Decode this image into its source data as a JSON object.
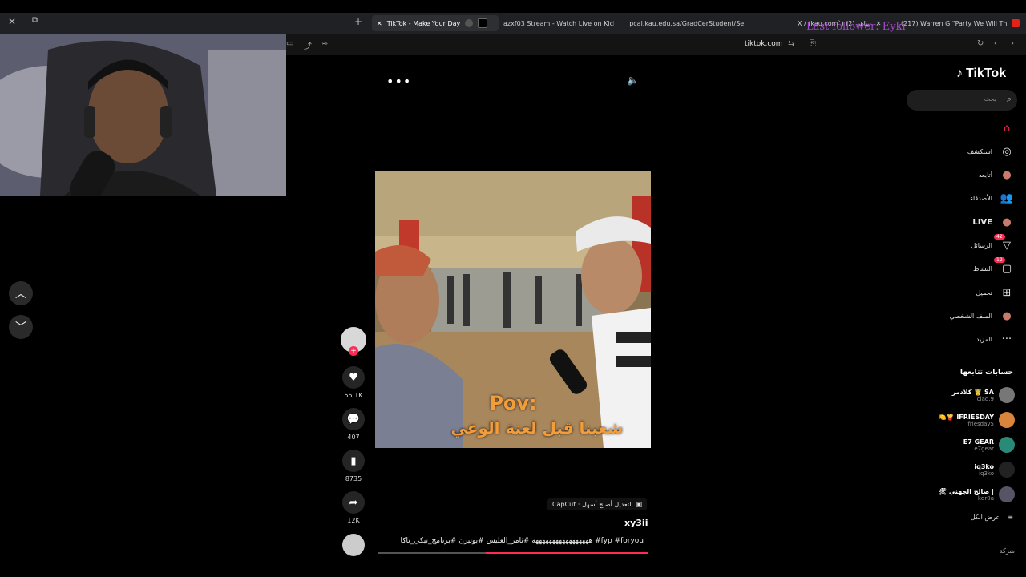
{
  "browser": {
    "tabs": [
      {
        "label": "TikTok - Make Your Day",
        "active": true
      },
      {
        "label": "azxf03 Stream - Watch Live on Kick"
      },
      {
        "label": "!pcal.kau.edu.sa/GradCerStudent/Se"
      },
      {
        "label": "X / (kau.com`) ساهر (2)"
      },
      {
        "label": "(217) Warren G \"Party We Will Th"
      }
    ],
    "url": "tiktok.com",
    "controls": {
      "close": "✕",
      "restore": "⧉",
      "minimize": "–",
      "new_tab": "+"
    }
  },
  "overlay": {
    "last_follower": "Last follower: Eyki"
  },
  "colors": {
    "accent": "#fe2c55",
    "sidebar_bg": "#000000",
    "overlay_text": "#a049c6"
  },
  "video": {
    "caption_pov": "Pov:",
    "caption_ar": "شعبنا قبل لعنة الوعي",
    "capcut_badge": "CapCut · التعديل أصبح أسهل",
    "author": "xy3ii",
    "description": "هههههههههههههههههه #ثامر_الغليس #يوتيرن #برنامج_تيكي_تاكا #fyp #foryou",
    "progress": 0.6
  },
  "actions": {
    "likes": "55.1K",
    "comments": "407",
    "saves": "8735",
    "shares": "12K"
  },
  "sidebar": {
    "logo": "TikTok",
    "search_placeholder": "بحث",
    "nav": [
      {
        "label": "",
        "icon": "home-icon"
      },
      {
        "label": "استكشف",
        "icon": "explore-icon"
      },
      {
        "label": "أتابعه",
        "icon": "following-avatar-icon"
      },
      {
        "label": "الأصدقاء",
        "icon": "friends-icon"
      },
      {
        "label": "LIVE",
        "icon": "live-icon"
      },
      {
        "label": "الرسائل",
        "icon": "messages-icon",
        "badge": "42"
      },
      {
        "label": "النشاط",
        "icon": "activity-icon",
        "badge": "12"
      },
      {
        "label": "تحميل",
        "icon": "upload-icon"
      },
      {
        "label": "الملف الشخصي",
        "icon": "profile-icon"
      },
      {
        "label": "المزيد",
        "icon": "more-icon"
      }
    ],
    "following_header": "حسابات تتابعها",
    "accounts": [
      {
        "name": "كلادمر 🤴 SA",
        "handle": "clad.9",
        "color": "#777"
      },
      {
        "name": "🍋🍟 IFRIESDAY",
        "handle": "friesday5",
        "color": "#d9853b"
      },
      {
        "name": "E7 GEAR",
        "handle": "e7gear",
        "color": "#2a8a78"
      },
      {
        "name": "iq3ko",
        "handle": "iq3ko",
        "color": "#222"
      },
      {
        "name": "🛠 صالح الجهني |",
        "handle": "kdr0a",
        "color": "#556"
      }
    ],
    "see_all": "عرض الكل",
    "company": "شركة"
  }
}
